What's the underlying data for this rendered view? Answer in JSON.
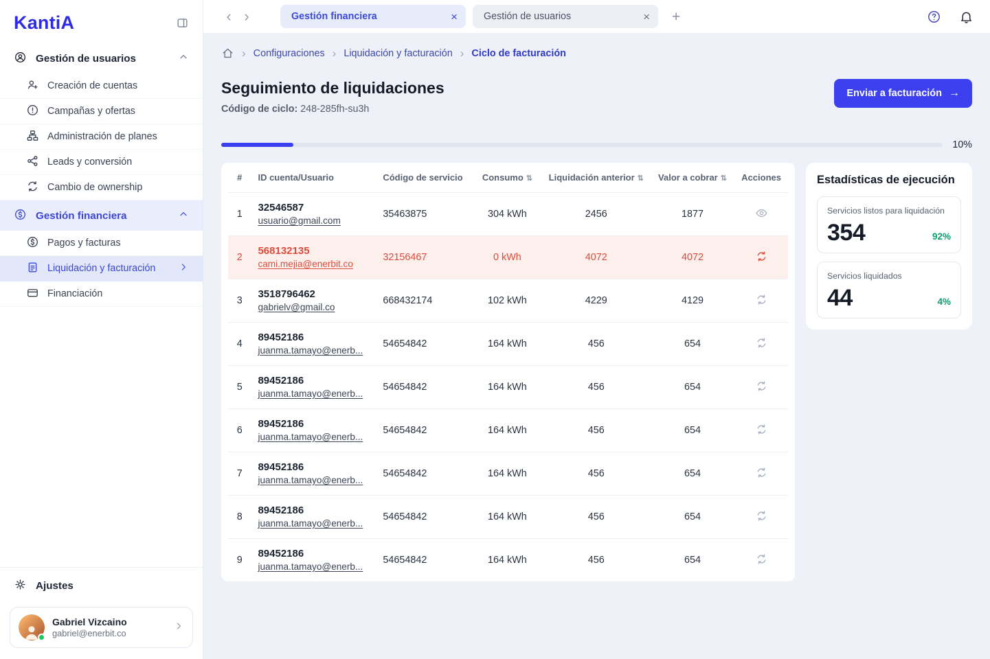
{
  "brand": {
    "name": "KantiA"
  },
  "glyphs": {
    "back": "‹",
    "forward": "›",
    "close": "×",
    "plus": "+",
    "sort": "⇅",
    "arrow_right": "→",
    "crumb_sep": "›"
  },
  "sidebar": {
    "sections": [
      {
        "label": "Gestión de usuarios",
        "items": [
          {
            "label": "Creación de cuentas"
          },
          {
            "label": "Campañas y ofertas"
          },
          {
            "label": "Administración de planes"
          },
          {
            "label": "Leads y conversión"
          },
          {
            "label": "Cambio de ownership"
          }
        ]
      },
      {
        "label": "Gestión financiera",
        "items": [
          {
            "label": "Pagos y facturas"
          },
          {
            "label": "Liquidación y facturación"
          },
          {
            "label": "Financiación"
          }
        ]
      }
    ],
    "settings_label": "Ajustes",
    "user": {
      "name": "Gabriel Vizcaino",
      "email": "gabriel@enerbit.co"
    }
  },
  "topbar": {
    "tabs": [
      {
        "label": "Gestión financiera"
      },
      {
        "label": "Gestión de usuarios"
      }
    ]
  },
  "breadcrumb": {
    "items": [
      "Configuraciones",
      "Liquidación y facturación",
      "Ciclo de facturación"
    ]
  },
  "page": {
    "title": "Seguimiento de liquidaciones",
    "cycle_label": "Código de ciclo:",
    "cycle_value": "248-285fh-su3h",
    "cta_label": "Enviar a facturación"
  },
  "progress": {
    "percent": 10,
    "label": "10%"
  },
  "table": {
    "columns": {
      "num": "#",
      "account": "ID cuenta/Usuario",
      "service_code": "Código de servicio",
      "consumption": "Consumo",
      "previous_settlement": "Liquidación anterior",
      "amount_due": "Valor a cobrar",
      "actions": "Acciones"
    },
    "rows": [
      {
        "num": "1",
        "account_id": "32546587",
        "user": "usuario@gmail.com",
        "service_code": "35463875",
        "consumption": "304 kWh",
        "previous": "2456",
        "amount": "1877",
        "action": "view"
      },
      {
        "num": "2",
        "account_id": "568132135",
        "user": "cami.mejia@enerbit.co",
        "service_code": "32156467",
        "consumption": "0 kWh",
        "previous": "4072",
        "amount": "4072",
        "action": "retry",
        "state": "error"
      },
      {
        "num": "3",
        "account_id": "3518796462",
        "user": "gabrielv@gmail.co",
        "service_code": "668432174",
        "consumption": "102 kWh",
        "previous": "4229",
        "amount": "4129",
        "action": "retry"
      },
      {
        "num": "4",
        "account_id": "89452186",
        "user": "juanma.tamayo@enerb...",
        "service_code": "54654842",
        "consumption": "164 kWh",
        "previous": "456",
        "amount": "654",
        "action": "retry"
      },
      {
        "num": "5",
        "account_id": "89452186",
        "user": "juanma.tamayo@enerb...",
        "service_code": "54654842",
        "consumption": "164 kWh",
        "previous": "456",
        "amount": "654",
        "action": "retry"
      },
      {
        "num": "6",
        "account_id": "89452186",
        "user": "juanma.tamayo@enerb...",
        "service_code": "54654842",
        "consumption": "164 kWh",
        "previous": "456",
        "amount": "654",
        "action": "retry"
      },
      {
        "num": "7",
        "account_id": "89452186",
        "user": "juanma.tamayo@enerb...",
        "service_code": "54654842",
        "consumption": "164 kWh",
        "previous": "456",
        "amount": "654",
        "action": "retry"
      },
      {
        "num": "8",
        "account_id": "89452186",
        "user": "juanma.tamayo@enerb...",
        "service_code": "54654842",
        "consumption": "164 kWh",
        "previous": "456",
        "amount": "654",
        "action": "retry"
      },
      {
        "num": "9",
        "account_id": "89452186",
        "user": "juanma.tamayo@enerb...",
        "service_code": "54654842",
        "consumption": "164 kWh",
        "previous": "456",
        "amount": "654",
        "action": "retry"
      }
    ]
  },
  "stats": {
    "title": "Estadísticas de ejecución",
    "cards": [
      {
        "label": "Servicios listos para liquidación",
        "value": "354",
        "percent": "92%"
      },
      {
        "label": "Servicios liquidados",
        "value": "44",
        "percent": "4%"
      }
    ]
  },
  "colors": {
    "accent": "#3c40ee",
    "accent_soft": "#e7ecfa",
    "error": "#dc4c3d",
    "error_bg": "#fdefec",
    "success": "#0aa06e"
  }
}
